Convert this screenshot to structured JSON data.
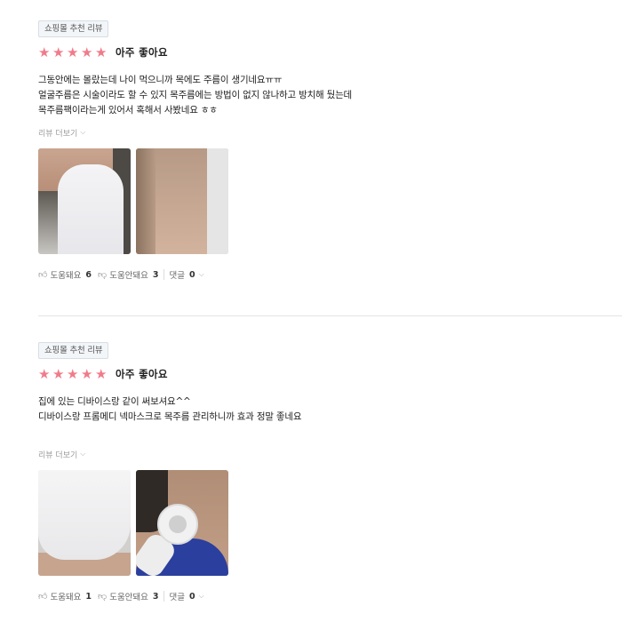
{
  "reviews": [
    {
      "badge": "쇼핑몰 추천 리뷰",
      "rating": 5,
      "rating_text": "아주 좋아요",
      "lines": [
        "그동안에는 몰랐는데 나이 먹으니까 목에도 주름이 생기네요ㅠㅠ",
        "얼굴주름은 시술이라도 할 수 있지 목주름에는 방법이 없지 않나하고 방치해 뒀는데",
        "목주름팩이라는게 있어서 혹해서 사봤네요 ㅎㅎ"
      ],
      "more_label": "리뷰 더보기",
      "photos": [
        "neck-mask-photo",
        "bare-neck-photo"
      ],
      "helpful_label": "도움돼요",
      "helpful_count": "6",
      "unhelpful_label": "도움안돼요",
      "unhelpful_count": "3",
      "comments_label": "댓글",
      "comments_count": "0"
    },
    {
      "badge": "쇼핑몰 추천 리뷰",
      "rating": 5,
      "rating_text": "아주 좋아요",
      "lines": [
        "집에 있는 디바이스랑 같이 써보셔요^^",
        "디바이스랑 프롬메디 넥마스크로 목주름 관리하니까 효과 정말 좋네요"
      ],
      "more_label": "리뷰 더보기",
      "photos": [
        "neck-mask-closeup-photo",
        "neck-device-photo"
      ],
      "helpful_label": "도움돼요",
      "helpful_count": "1",
      "unhelpful_label": "도움안돼요",
      "unhelpful_count": "3",
      "comments_label": "댓글",
      "comments_count": "0"
    }
  ],
  "colors": {
    "star": "#f07b8a",
    "badge_bg": "#f3f6f9",
    "divider": "#e4e4e4"
  },
  "icons": {
    "star": "star-icon",
    "thumbs_up": "thumbs-up-icon",
    "thumbs_down": "thumbs-down-icon",
    "chevron": "chevron-down-icon"
  }
}
